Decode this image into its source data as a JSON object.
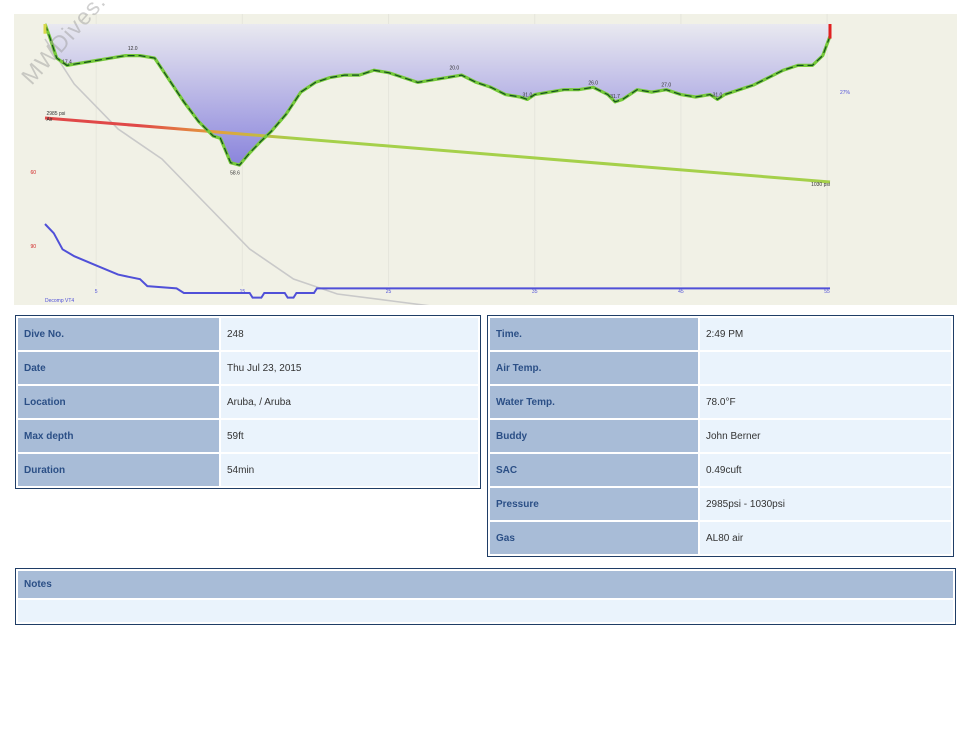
{
  "watermark": "MWDives.com",
  "colors": {
    "plot_bg": "#f1f1e6",
    "depth_fill_top": "#e9e9f0",
    "depth_fill_bottom": "#8a84dc",
    "depth_line_dark": "#14501e",
    "depth_line_light": "#76c93a",
    "temp_line": "#c9c9c9",
    "pressure_good": "#a5d04a",
    "pressure_warm": "#e4a13c",
    "pressure_hot": "#e04848",
    "ceiling_line": "#5050d8",
    "ascent_marker": "#e02020",
    "label_blue": "#2b4f86",
    "label_bg": "#a8bcd7",
    "value_bg": "#eaf3fc"
  },
  "chart_data": {
    "type": "line",
    "x_ticks": [
      "5",
      "15",
      "25",
      "35",
      "45",
      "55"
    ],
    "depth_annotations": [
      {
        "x": 1.5,
        "y": 17.4,
        "label": "17.4"
      },
      {
        "x": 6.0,
        "y": 12.0,
        "label": "12.0"
      },
      {
        "x": 13.0,
        "y": 58.6,
        "label": "58.6"
      },
      {
        "x": 28.0,
        "y": 20.0,
        "label": "20.0"
      },
      {
        "x": 33.0,
        "y": 31.0,
        "label": "31.0"
      },
      {
        "x": 37.5,
        "y": 26.0,
        "label": "26.0"
      },
      {
        "x": 39.0,
        "y": 31.7,
        "label": "31.7"
      },
      {
        "x": 42.5,
        "y": 27.0,
        "label": "27.0"
      },
      {
        "x": 46.0,
        "y": 31.0,
        "label": "31.0"
      }
    ],
    "depth_profile": {
      "x": [
        0,
        0.3,
        0.8,
        1.5,
        2.5,
        3.5,
        4.5,
        5.5,
        6.5,
        7.5,
        8.5,
        9.5,
        10.5,
        11.5,
        12.0,
        12.7,
        13.3,
        14.0,
        14.8,
        15.5,
        16.5,
        17.5,
        18.5,
        19.5,
        20.5,
        21.5,
        22.5,
        23.5,
        24.5,
        25.5,
        26.5,
        27.5,
        28.5,
        29.5,
        30.5,
        31.5,
        32.5,
        33.0,
        33.5,
        34.5,
        35.5,
        36.5,
        37.5,
        38.5,
        39.0,
        39.5,
        40.5,
        41.5,
        42.5,
        43.5,
        44.5,
        45.5,
        46.0,
        46.5,
        47.5,
        48.5,
        49.5,
        50.5,
        51.5,
        52.5,
        53.2,
        53.7
      ],
      "y": [
        0,
        5,
        14,
        17,
        16,
        15,
        14,
        13,
        13,
        14,
        23,
        32,
        40,
        46,
        47,
        57,
        58,
        53,
        48,
        44,
        37,
        28,
        24,
        22,
        21,
        21,
        19,
        20,
        22,
        24,
        23,
        22,
        21,
        24,
        26,
        29,
        30,
        31,
        29,
        28,
        27,
        27,
        26,
        29,
        32,
        31,
        27,
        28,
        27,
        29,
        30,
        29,
        31,
        29,
        27,
        25,
        22,
        19,
        17,
        17,
        13,
        5
      ]
    },
    "temperature_series": {
      "x": [
        0,
        2,
        5,
        8,
        11,
        14,
        17,
        20,
        24,
        28,
        33,
        38,
        43,
        48,
        53.7
      ],
      "y": [
        100,
        97,
        94,
        92,
        89,
        86,
        84,
        83,
        82.5,
        82,
        81.5,
        81.3,
        81,
        80.8,
        80.5
      ]
    },
    "pressure_series": {
      "x": [
        0,
        53.7
      ],
      "y": [
        2985,
        1030
      ]
    },
    "ceiling_series": {
      "x": [
        0,
        0.6,
        1.2,
        2.0,
        3.5,
        5.0,
        6.5,
        7.0,
        9.0,
        9.5,
        14.0,
        14.2,
        14.8,
        15.0,
        16.4,
        16.6,
        17.0,
        17.2,
        18.4,
        18.6,
        53.7
      ],
      "y": [
        20,
        24,
        31,
        34,
        38,
        42,
        44,
        47,
        48,
        50,
        50,
        52,
        52,
        50,
        50,
        52,
        52,
        50,
        50,
        48,
        48
      ]
    },
    "side_labels": {
      "pressure_start": "2985 psi",
      "pressure_end": "1030 psi",
      "temp_end": "27%",
      "air": "Air"
    },
    "y_left_labels": [
      "60",
      "90"
    ],
    "bottom_left": "Decomp VT4"
  },
  "left_table": [
    {
      "label": "Dive No.",
      "value": "248"
    },
    {
      "label": "Date",
      "value": "Thu Jul 23, 2015"
    },
    {
      "label": "Location",
      "value": "Aruba, / Aruba"
    },
    {
      "label": "Max depth",
      "value": "59ft"
    },
    {
      "label": "Duration",
      "value": "54min"
    }
  ],
  "right_table": [
    {
      "label": "Time.",
      "value": "2:49 PM"
    },
    {
      "label": "Air Temp.",
      "value": ""
    },
    {
      "label": "Water Temp.",
      "value": "78.0°F"
    },
    {
      "label": "Buddy",
      "value": "John Berner"
    },
    {
      "label": "SAC",
      "value": "0.49cuft"
    },
    {
      "label": "Pressure",
      "value": "2985psi - 1030psi"
    },
    {
      "label": "Gas",
      "value": "AL80 air"
    }
  ],
  "notes": {
    "label": "Notes",
    "value": ""
  }
}
